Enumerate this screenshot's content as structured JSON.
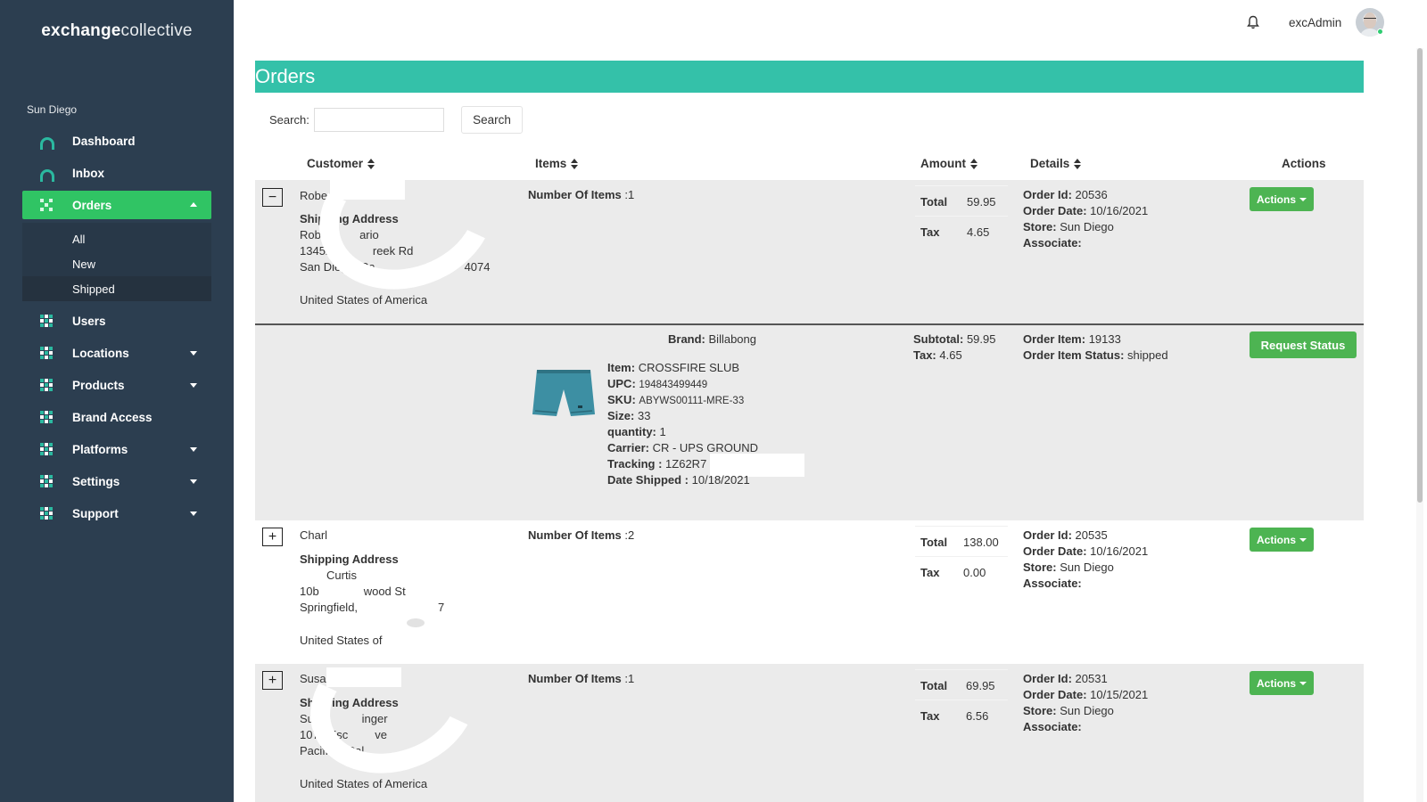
{
  "app": {
    "logo_bold": "exchange",
    "logo_light": "collective",
    "store_name": "Sun Diego"
  },
  "sidebar": {
    "items": [
      {
        "label": "Dashboard",
        "icon": "arc-icon"
      },
      {
        "label": "Inbox",
        "icon": "arc-icon"
      },
      {
        "label": "Orders",
        "icon": "dots-icon",
        "active": true,
        "expanded": true,
        "subitems": [
          {
            "label": "All"
          },
          {
            "label": "New"
          },
          {
            "label": "Shipped",
            "selected": true
          }
        ]
      },
      {
        "label": "Users",
        "icon": "grid-icon"
      },
      {
        "label": "Locations",
        "icon": "grid-icon",
        "has_caret": true
      },
      {
        "label": "Products",
        "icon": "grid-icon",
        "has_caret": true
      },
      {
        "label": "Brand Access",
        "icon": "grid-icon"
      },
      {
        "label": "Platforms",
        "icon": "grid-icon",
        "has_caret": true
      },
      {
        "label": "Settings",
        "icon": "grid-icon",
        "has_caret": true
      },
      {
        "label": "Support",
        "icon": "grid-icon",
        "has_caret": true
      }
    ]
  },
  "topbar": {
    "username": "excAdmin",
    "notification_icon": "bell-icon",
    "status": "online"
  },
  "page": {
    "title": "Orders",
    "search_label": "Search:",
    "search_value": "",
    "search_button": "Search"
  },
  "table": {
    "headers": {
      "customer": "Customer",
      "items": "Items",
      "amount": "Amount",
      "details": "Details",
      "actions": "Actions"
    },
    "labels": {
      "shipping_address": "Shipping Address",
      "number_of_items": "Number Of Items",
      "total": "Total",
      "tax": "Tax",
      "order_id": "Order Id:",
      "order_date": "Order Date:",
      "store": "Store:",
      "associate": "Associate:",
      "actions_button": "Actions"
    },
    "orders": [
      {
        "toggle": "−",
        "customer": "Rober",
        "address_line1": "Robe",
        "address_line1b": "ario",
        "address_line2": "13452 G",
        "address_line2b": "reek Rd",
        "address_line3": "San Diego, Ca",
        "address_line3b": "4074",
        "country": "United States of America",
        "num_items": ":1",
        "total": "59.95",
        "tax": "4.65",
        "order_id": "20536",
        "order_date": "10/16/2021",
        "store": "Sun Diego",
        "associate": ""
      },
      {
        "toggle": "+",
        "customer": "Charl",
        "address_line1": "Curtis",
        "address_line2": "10b",
        "address_line2b": "wood St",
        "address_line3": "Springfield,",
        "address_line3b": "7",
        "country": "United States of",
        "num_items": ":2",
        "total": "138.00",
        "tax": "0.00",
        "order_id": "20535",
        "order_date": "10/16/2021",
        "store": "Sun Diego",
        "associate": ""
      },
      {
        "toggle": "+",
        "customer": "Susa",
        "address_line1": "Susa",
        "address_line1b": "inger",
        "address_line2": "1072 Esc",
        "address_line2b": "ve",
        "address_line3": "Pacifica, Cal",
        "country": "United States of America",
        "num_items": ":1",
        "total": "69.95",
        "tax": "6.56",
        "order_id": "20531",
        "order_date": "10/15/2021",
        "store": "Sun Diego",
        "associate": ""
      }
    ],
    "expanded_item": {
      "brand_label": "Brand:",
      "brand": "Billabong",
      "item_label": "Item:",
      "item": "CROSSFIRE SLUB",
      "upc_label": "UPC:",
      "upc": "194843499449",
      "sku_label": "SKU:",
      "sku": "ABYWS00111-MRE-33",
      "size_label": "Size:",
      "size": "33",
      "quantity_label": "quantity:",
      "quantity": "1",
      "carrier_label": "Carrier:",
      "carrier": "CR - UPS GROUND",
      "tracking_label": "Tracking :",
      "tracking": "1Z62R7",
      "date_shipped_label": "Date Shipped :",
      "date_shipped": "10/18/2021",
      "subtotal_label": "Subtotal:",
      "subtotal": "59.95",
      "tax_label": "Tax:",
      "tax": "4.65",
      "order_item_label": "Order Item:",
      "order_item": "19133",
      "order_item_status_label": "Order Item Status:",
      "order_item_status": "shipped",
      "request_status_button": "Request Status",
      "product_image": "blue shorts"
    }
  },
  "colors": {
    "sidebar_bg": "#2c3e50",
    "active_green": "#30c464",
    "header_teal": "#34c1a9",
    "button_green": "#4db452",
    "row_gray": "#ebebeb"
  }
}
